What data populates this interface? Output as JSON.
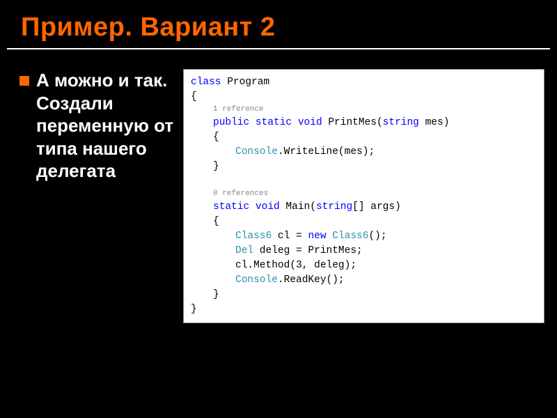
{
  "title": "Пример. Вариант 2",
  "bullet": "А можно и так. Создали переменную от типа нашего делегата",
  "code": {
    "l01a": "class",
    "l01b": " Program",
    "l02": "{",
    "ref1": "1 reference",
    "l03_kw1": "public",
    "l03_sp1": " ",
    "l03_kw2": "static",
    "l03_sp2": " ",
    "l03_kw3": "void",
    "l03_sp3": " PrintMes(",
    "l03_kw4": "string",
    "l03_sp4": " mes)",
    "l04": "{",
    "l05a": "Console",
    "l05b": ".WriteLine(mes);",
    "l06": "}",
    "ref2": "0 references",
    "l07_kw1": "static",
    "l07_sp1": " ",
    "l07_kw2": "void",
    "l07_sp2": " Main(",
    "l07_kw3": "string",
    "l07_sp3": "[] args)",
    "l08": "{",
    "l09a": "Class6",
    "l09b": " cl = ",
    "l09c": "new",
    "l09d": " ",
    "l09e": "Class6",
    "l09f": "();",
    "l10a": "Del",
    "l10b": " deleg = PrintMes;",
    "l11": "cl.Method(3, deleg);",
    "l12a": "Console",
    "l12b": ".ReadKey();",
    "l13": "}",
    "l14": "}"
  }
}
